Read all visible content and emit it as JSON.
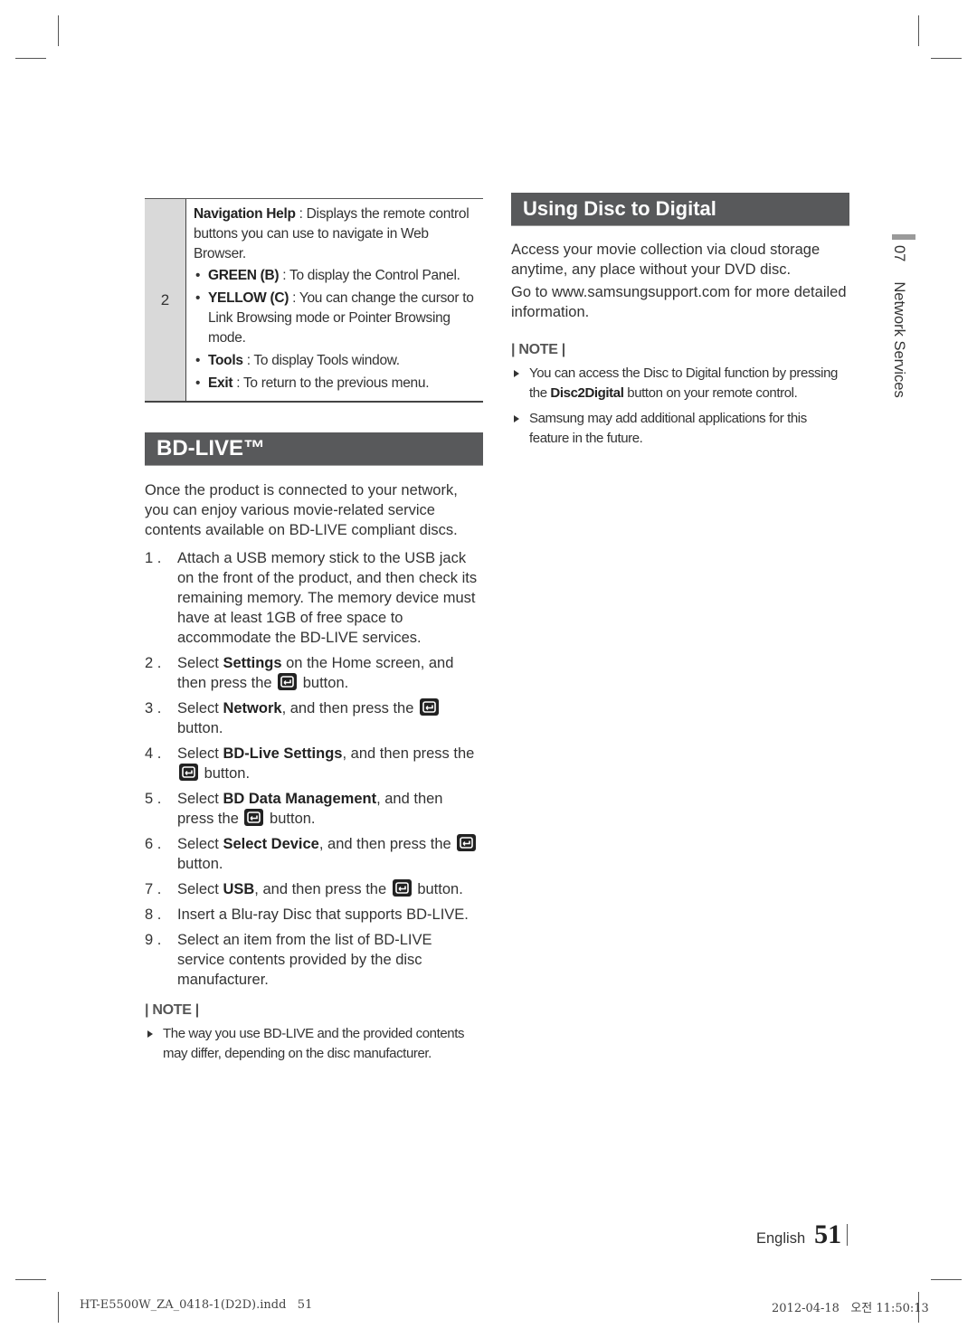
{
  "info_table": {
    "row_number": "2",
    "intro_bold": "Navigation Help",
    "intro_text": " : Displays the remote control buttons you can use to navigate in Web Browser.",
    "items": [
      {
        "bold": "GREEN (B)",
        "text": " : To display the Control Panel."
      },
      {
        "bold": "YELLOW (C)",
        "text": " : You can change the cursor to Link Browsing mode or Pointer Browsing mode."
      },
      {
        "bold": "Tools",
        "text": " : To display Tools window."
      },
      {
        "bold": "Exit",
        "text": " : To return to the previous menu."
      }
    ]
  },
  "bd_live": {
    "title": "BD-LIVE™",
    "intro": "Once the product is connected to your network, you can enjoy various movie-related service contents available on BD-LIVE compliant discs.",
    "steps": [
      {
        "num": "1 .",
        "pre": "Attach a USB memory stick to the USB jack on the front of the product, and then check its remaining memory. The memory device must have at least 1GB of free space to accommodate the BD-LIVE services.",
        "bold": "",
        "post": "",
        "button": "",
        "tail": ""
      },
      {
        "num": "2 .",
        "pre": "Select ",
        "bold": "Settings",
        "post": " on the Home screen, and then press the ",
        "button": "enter",
        "tail": " button."
      },
      {
        "num": "3 .",
        "pre": "Select ",
        "bold": "Network",
        "post": ", and then press the ",
        "button": "enter",
        "tail": " button."
      },
      {
        "num": "4 .",
        "pre": "Select ",
        "bold": "BD-Live Settings",
        "post": ", and then press the ",
        "button": "enter",
        "tail": " button."
      },
      {
        "num": "5 .",
        "pre": "Select ",
        "bold": "BD Data Management",
        "post": ", and then press the ",
        "button": "enter",
        "tail": " button."
      },
      {
        "num": "6 .",
        "pre": "Select ",
        "bold": "Select Device",
        "post": ", and then press the ",
        "button": "enter",
        "tail": " button."
      },
      {
        "num": "7 .",
        "pre": "Select ",
        "bold": "USB",
        "post": ", and then press the ",
        "button": "enter",
        "tail": " button."
      },
      {
        "num": "8 .",
        "pre": "Insert a Blu-ray Disc that supports BD-LIVE.",
        "bold": "",
        "post": "",
        "button": "",
        "tail": ""
      },
      {
        "num": "9 .",
        "pre": "Select an item from the list of BD-LIVE service contents provided by the disc manufacturer.",
        "bold": "",
        "post": "",
        "button": "",
        "tail": ""
      }
    ],
    "note_label": "| NOTE |",
    "notes": [
      {
        "pre": "The way you use BD-LIVE and the provided contents may differ, depending on the disc manufacturer.",
        "bold": "",
        "post": ""
      }
    ]
  },
  "disc_to_digital": {
    "title": "Using Disc to Digital",
    "paragraphs": [
      "Access your movie collection via cloud storage anytime, any place without your DVD disc.",
      "Go to www.samsungsupport.com for more detailed information."
    ],
    "note_label": "| NOTE |",
    "notes": [
      {
        "pre": "You can access the Disc to Digital function by pressing the ",
        "bold": "Disc2Digital",
        "post": " button on your remote control."
      },
      {
        "pre": "Samsung may add additional applications for this feature in the future.",
        "bold": "",
        "post": ""
      }
    ]
  },
  "side_tab": {
    "chapter": "07",
    "section": "Network Services"
  },
  "footer": {
    "language": "English",
    "page_number": "51"
  },
  "print_slug": {
    "file": "HT-E5500W_ZA_0418-1(D2D).indd   51",
    "datetime": "2012-04-18   오전 11:50:13"
  },
  "colors": {
    "section_header_bg": "#58595b",
    "table_number_bg": "#d9d9d9",
    "side_tab_bar": "#9a9a9a"
  }
}
